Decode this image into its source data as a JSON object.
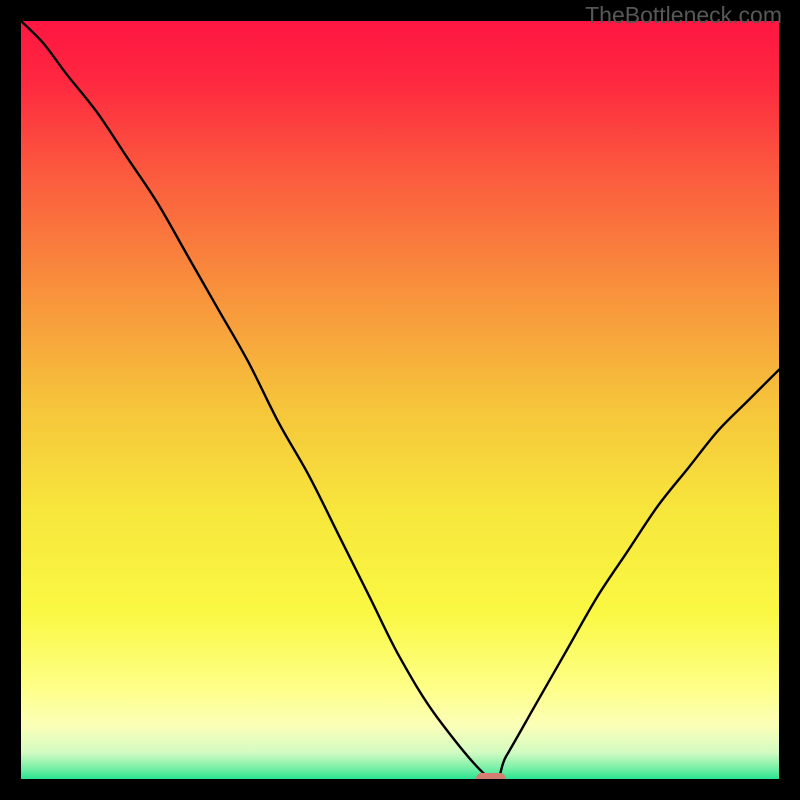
{
  "watermark": "TheBottleneck.com",
  "chart_data": {
    "type": "line",
    "title": "",
    "xlabel": "",
    "ylabel": "",
    "xlim": [
      0,
      100
    ],
    "ylim": [
      0,
      100
    ],
    "x": [
      0,
      3,
      6,
      10,
      14,
      18,
      22,
      26,
      30,
      34,
      38,
      42,
      46,
      50,
      55,
      62,
      64,
      68,
      72,
      76,
      80,
      84,
      88,
      92,
      96,
      100
    ],
    "values": [
      100,
      97,
      93,
      88,
      82,
      76,
      69,
      62,
      55,
      47,
      40,
      32,
      24,
      16,
      8,
      0,
      3,
      10,
      17,
      24,
      30,
      36,
      41,
      46,
      50,
      54
    ],
    "annotations": {
      "marker_x": 62,
      "marker_y": 0,
      "marker_color": "#d47d72"
    },
    "background": {
      "type": "vertical_gradient",
      "stops": [
        {
          "pos": 0.0,
          "color": "#fe1642"
        },
        {
          "pos": 0.08,
          "color": "#fe2840"
        },
        {
          "pos": 0.2,
          "color": "#fb5a3e"
        },
        {
          "pos": 0.35,
          "color": "#f88f3c"
        },
        {
          "pos": 0.5,
          "color": "#f6c23b"
        },
        {
          "pos": 0.65,
          "color": "#f7e73c"
        },
        {
          "pos": 0.78,
          "color": "#faf843"
        },
        {
          "pos": 0.88,
          "color": "#feff88"
        },
        {
          "pos": 0.93,
          "color": "#fbffb8"
        },
        {
          "pos": 0.965,
          "color": "#d3fbc2"
        },
        {
          "pos": 0.985,
          "color": "#7cf0a8"
        },
        {
          "pos": 1.0,
          "color": "#28e490"
        }
      ]
    }
  }
}
